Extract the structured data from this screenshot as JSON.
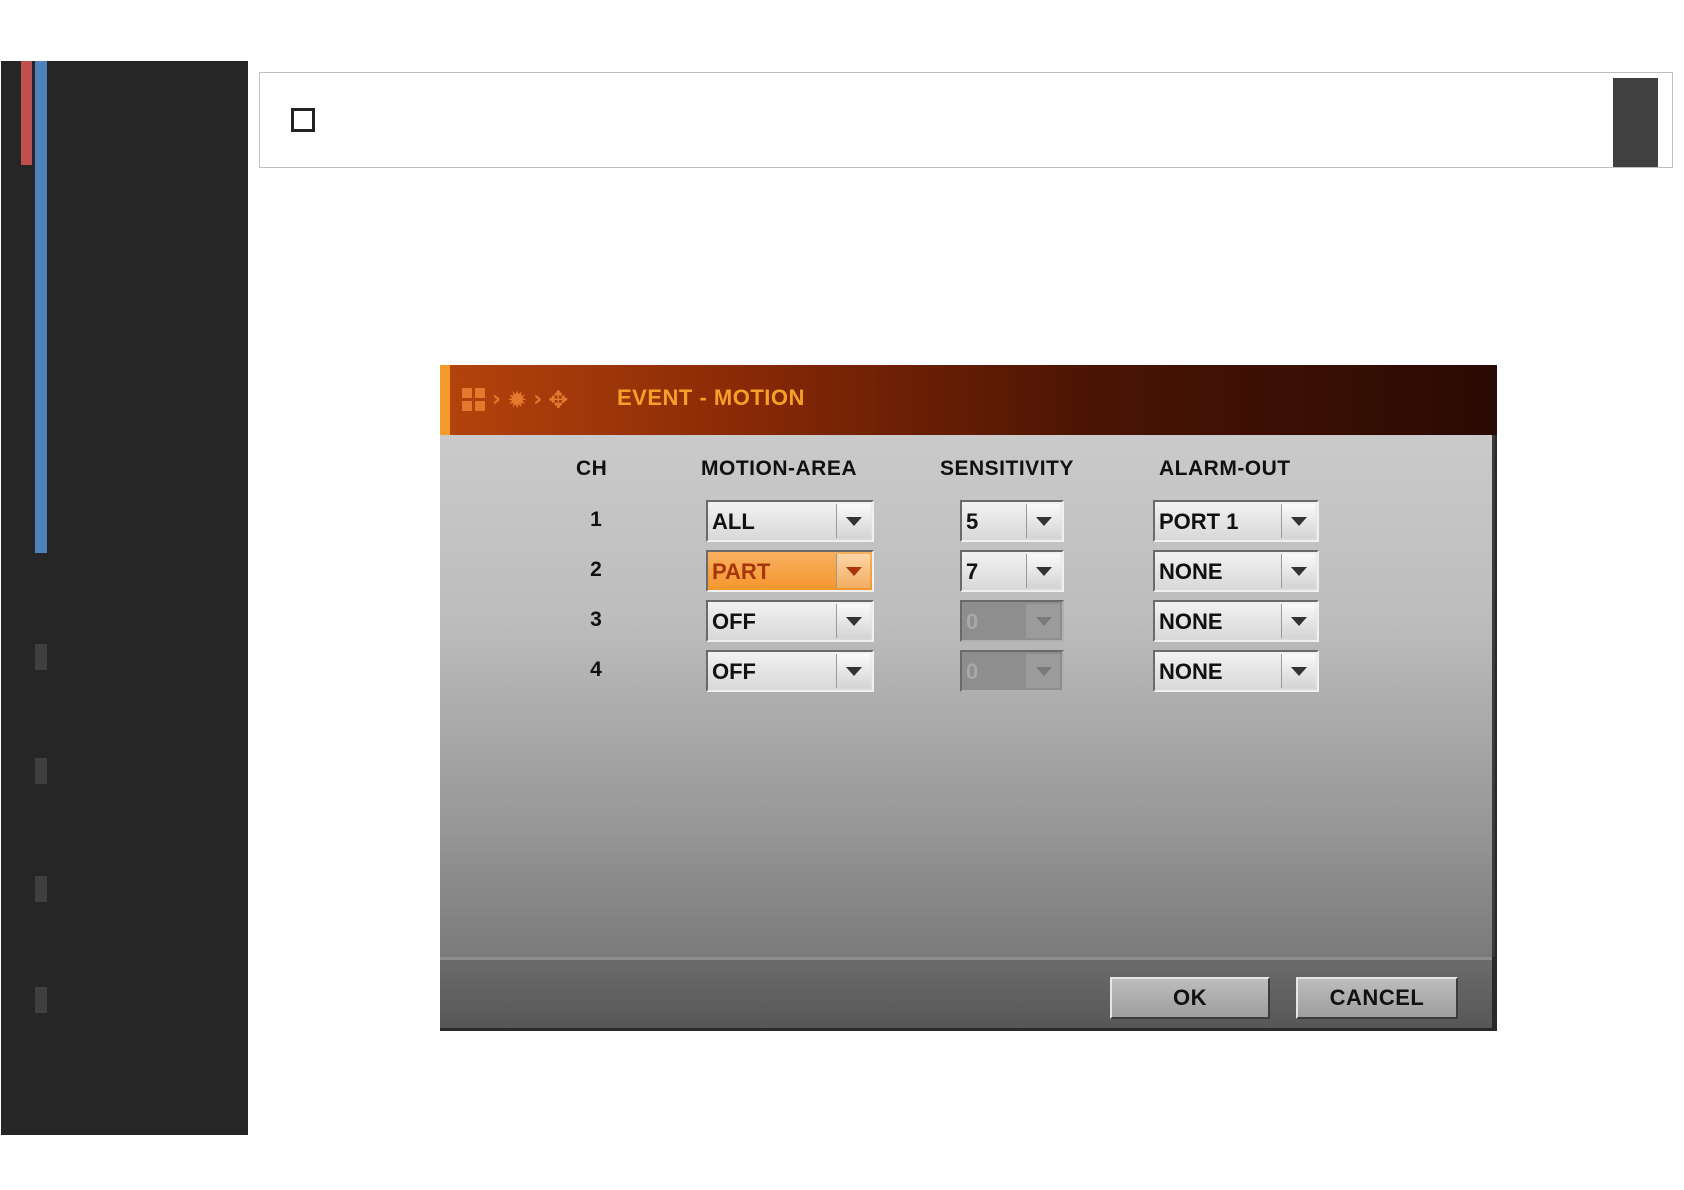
{
  "dialog": {
    "title": "EVENT - MOTION",
    "breadcrumb_icons": [
      "grid-icon",
      "chevron-right-icon",
      "gear-icon",
      "chevron-right-icon",
      "move-icon"
    ],
    "columns": {
      "ch": "CH",
      "motion_area": "MOTION-AREA",
      "sensitivity": "SENSITIVITY",
      "alarm_out": "ALARM-OUT"
    },
    "rows": [
      {
        "ch": "1",
        "motion_area": "ALL",
        "sensitivity": "5",
        "alarm_out": "PORT 1"
      },
      {
        "ch": "2",
        "motion_area": "PART",
        "sensitivity": "7",
        "alarm_out": "NONE"
      },
      {
        "ch": "3",
        "motion_area": "OFF",
        "sensitivity": "0",
        "alarm_out": "NONE"
      },
      {
        "ch": "4",
        "motion_area": "OFF",
        "sensitivity": "0",
        "alarm_out": "NONE"
      }
    ],
    "ok_label": "OK",
    "cancel_label": "CANCEL"
  },
  "colors": {
    "header_accent": "#f39a2a",
    "title_text": "#f5a028",
    "active_field": "#f4962e",
    "sidebar_bg": "#262626",
    "sidebar_red": "#c0504d",
    "sidebar_blue": "#4f81bd"
  }
}
